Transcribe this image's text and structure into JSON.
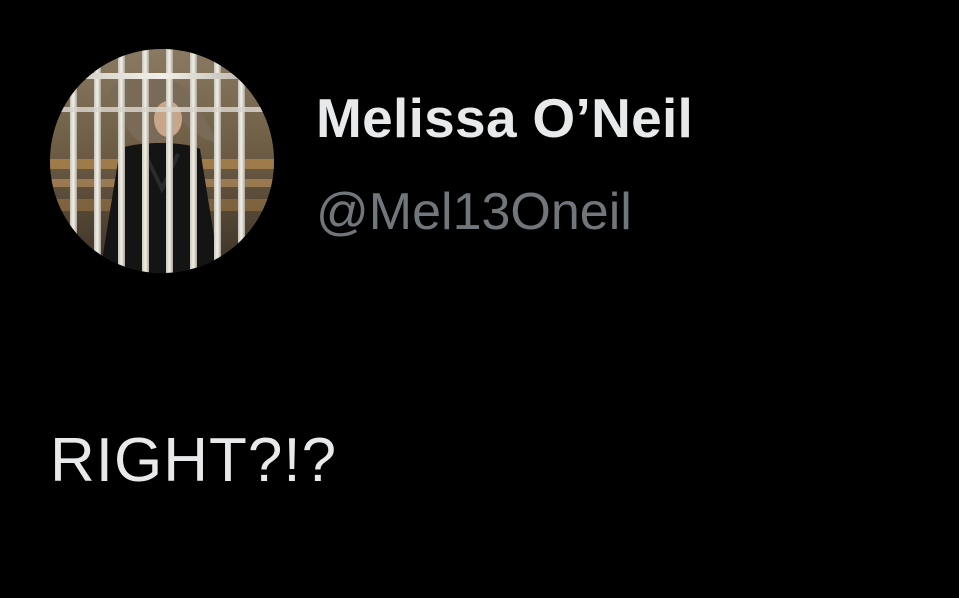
{
  "tweet": {
    "author": {
      "display_name": "Melissa O’Neil",
      "handle": "@Mel13Oneil",
      "avatar_icon": "profile-photo-behind-bars"
    },
    "text": "RIGHT?!?"
  },
  "colors": {
    "background": "#000000",
    "primary_text": "#e7e9ea",
    "secondary_text": "#71767b"
  }
}
